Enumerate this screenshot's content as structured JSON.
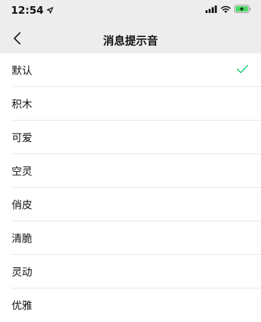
{
  "status_bar": {
    "time": "12:54",
    "icons": [
      "location-arrow-icon",
      "signal-icon",
      "wifi-icon",
      "battery-charging-icon"
    ]
  },
  "nav": {
    "title": "消息提示音",
    "back_icon": "chevron-left-icon"
  },
  "sounds": [
    {
      "label": "默认",
      "selected": true
    },
    {
      "label": "积木",
      "selected": false
    },
    {
      "label": "可爱",
      "selected": false
    },
    {
      "label": "空灵",
      "selected": false
    },
    {
      "label": "俏皮",
      "selected": false
    },
    {
      "label": "清脆",
      "selected": false
    },
    {
      "label": "灵动",
      "selected": false
    },
    {
      "label": "优雅",
      "selected": false
    }
  ],
  "colors": {
    "header_bg": "#ededed",
    "checkmark": "#07c160",
    "battery_charge": "#4cd964"
  }
}
